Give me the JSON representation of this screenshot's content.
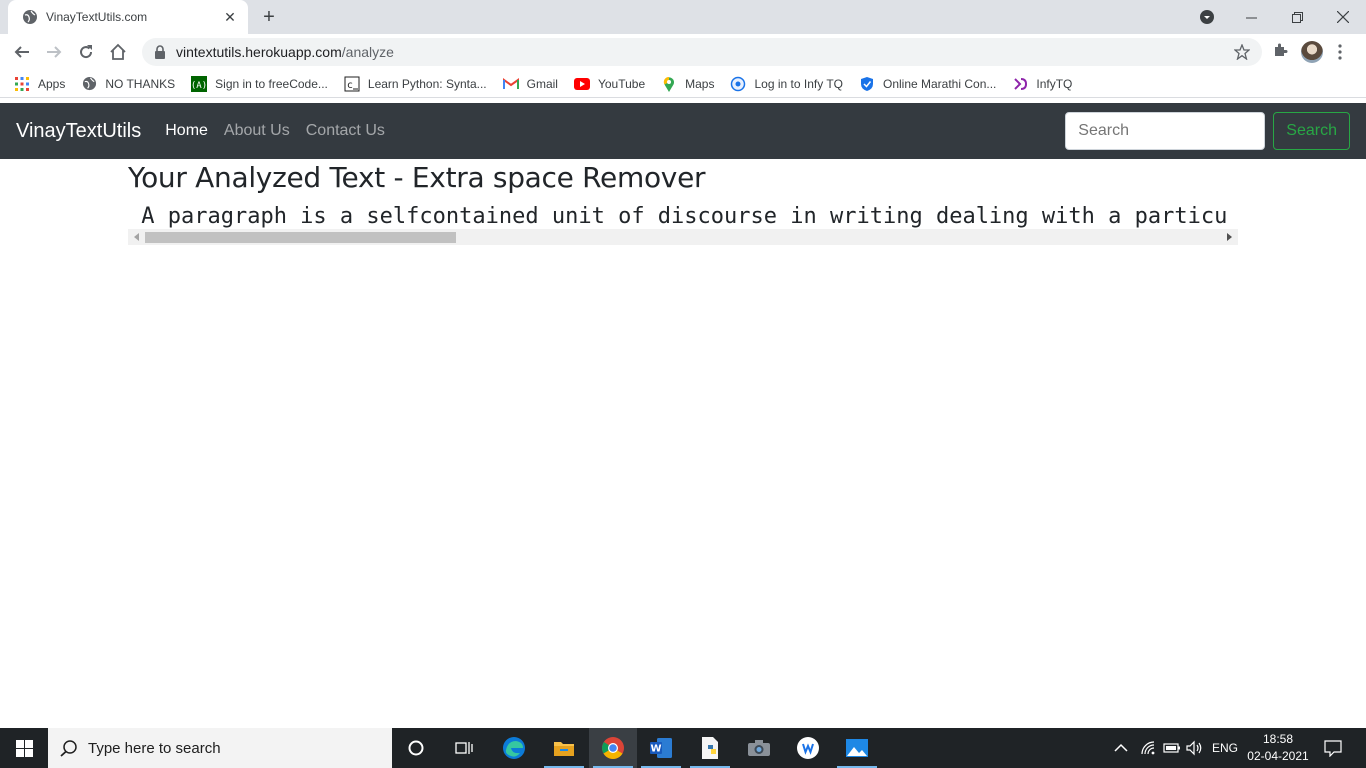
{
  "browser": {
    "tab_title": "VinayTextUtils.com",
    "url_host": "vintextutils.herokuapp.com",
    "url_path": "/analyze",
    "bookmarks": [
      {
        "label": "Apps",
        "icon": "apps-grid-icon"
      },
      {
        "label": "NO THANKS",
        "icon": "globe-icon"
      },
      {
        "label": "Sign in to freeCode...",
        "icon": "freecodecamp-icon"
      },
      {
        "label": "Learn Python: Synta...",
        "icon": "codecademy-icon"
      },
      {
        "label": "Gmail",
        "icon": "gmail-icon"
      },
      {
        "label": "YouTube",
        "icon": "youtube-icon"
      },
      {
        "label": "Maps",
        "icon": "maps-icon"
      },
      {
        "label": "Log in to Infy TQ",
        "icon": "infytq-login-icon"
      },
      {
        "label": "Online Marathi Con...",
        "icon": "shield-icon"
      },
      {
        "label": "InfyTQ",
        "icon": "infytq-icon"
      }
    ]
  },
  "site": {
    "brand": "VinayTextUtils",
    "nav": {
      "home": "Home",
      "about": "About Us",
      "contact": "Contact Us"
    },
    "search_placeholder": "Search",
    "search_button": "Search"
  },
  "main": {
    "heading": "Your Analyzed Text - Extra space Remover",
    "analyzed_text": " A paragraph is a selfcontained unit of discourse in writing dealing with a particu",
    "scroll_position": 0.0
  },
  "taskbar": {
    "search_placeholder": "Type here to search",
    "language": "ENG",
    "time": "18:58",
    "date": "02-04-2021"
  },
  "colors": {
    "navbar_bg": "#343a40",
    "search_button": "#28a745"
  }
}
